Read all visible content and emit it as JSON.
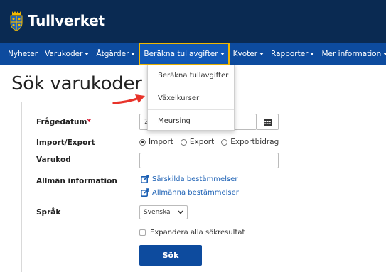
{
  "header": {
    "logo_text": "Tullverket"
  },
  "nav": {
    "items": [
      {
        "label": "Nyheter",
        "has_caret": false
      },
      {
        "label": "Varukoder",
        "has_caret": true
      },
      {
        "label": "Åtgärder",
        "has_caret": true
      },
      {
        "label": "Beräkna tullavgifter",
        "has_caret": true,
        "active": true
      },
      {
        "label": "Kvoter",
        "has_caret": true
      },
      {
        "label": "Rapporter",
        "has_caret": true
      },
      {
        "label": "Mer information",
        "has_caret": true
      }
    ]
  },
  "page": {
    "title": "Sök varukoder"
  },
  "form": {
    "date_label": "Frågedatum",
    "date_required": "*",
    "date_value": "2",
    "import_export_label": "Import/Export",
    "radio_options": [
      {
        "label": "Import",
        "checked": true
      },
      {
        "label": "Export",
        "checked": false
      },
      {
        "label": "Exportbidrag",
        "checked": false
      }
    ],
    "varukod_label": "Varukod",
    "varukod_value": "",
    "info_label": "Allmän information",
    "links": [
      "Särskilda bestämmelser",
      "Allmänna bestämmelser"
    ],
    "language_label": "Språk",
    "language_selected": "Svenska",
    "expand_label": "Expandera alla sökresultat",
    "search_button": "Sök"
  },
  "dropdown": {
    "items": [
      "Beräkna tullavgifter",
      "Växelkurser",
      "Meursing"
    ]
  },
  "colors": {
    "header_bg": "#0a2a52",
    "nav_bg": "#0d4b9e",
    "active_border": "#f2b800",
    "link": "#1a5fb4",
    "arrow": "#e8332a",
    "required": "#d0021b"
  },
  "icons": {
    "calendar": "calendar-icon",
    "external_link": "external-link-icon",
    "crest": "crest-icon"
  }
}
